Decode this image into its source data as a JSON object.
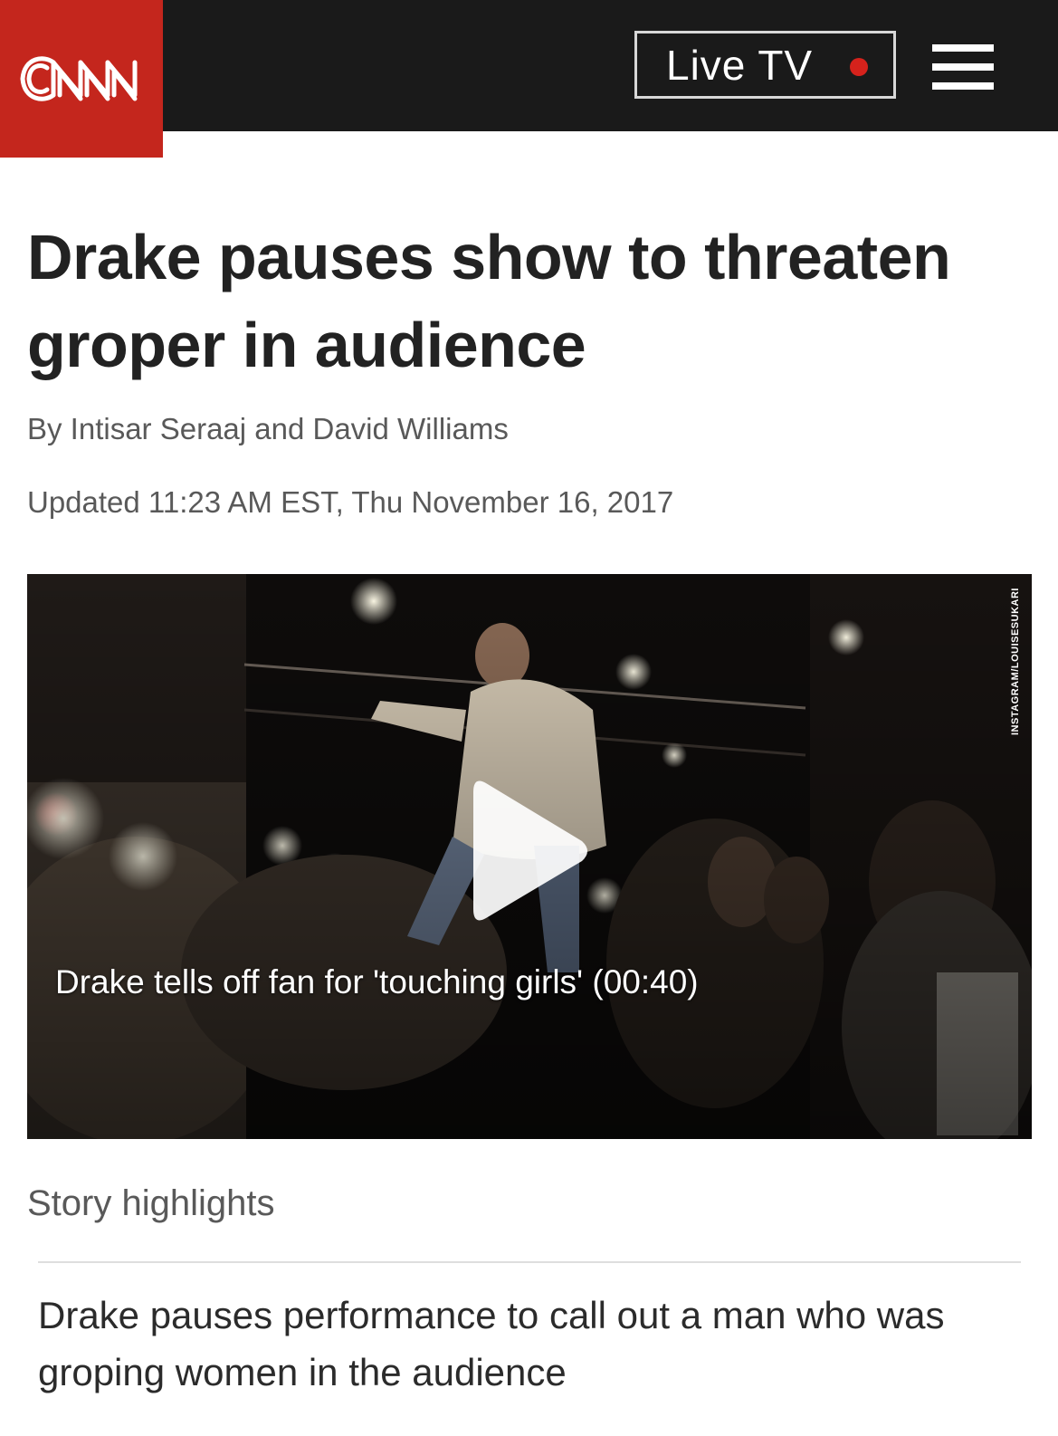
{
  "header": {
    "logo_text": "CNN",
    "live_tv_label": "Live TV",
    "menu_icon": "hamburger-menu-icon",
    "brand_color": "#c4261d",
    "live_dot_color": "#d6221c"
  },
  "article": {
    "headline": "Drake pauses show to threaten groper in audience",
    "byline": "By Intisar Seraaj and David Williams",
    "timestamp": "Updated 11:23 AM EST, Thu November 16, 2017"
  },
  "video": {
    "caption": "Drake tells off fan for 'touching girls' (00:40)",
    "credit": "INSTAGRAM/LOUISESUKARI",
    "play_icon": "play-icon"
  },
  "story_highlights": {
    "title": "Story highlights",
    "items": [
      "Drake pauses performance to call out a man who was groping women in the audience"
    ]
  }
}
